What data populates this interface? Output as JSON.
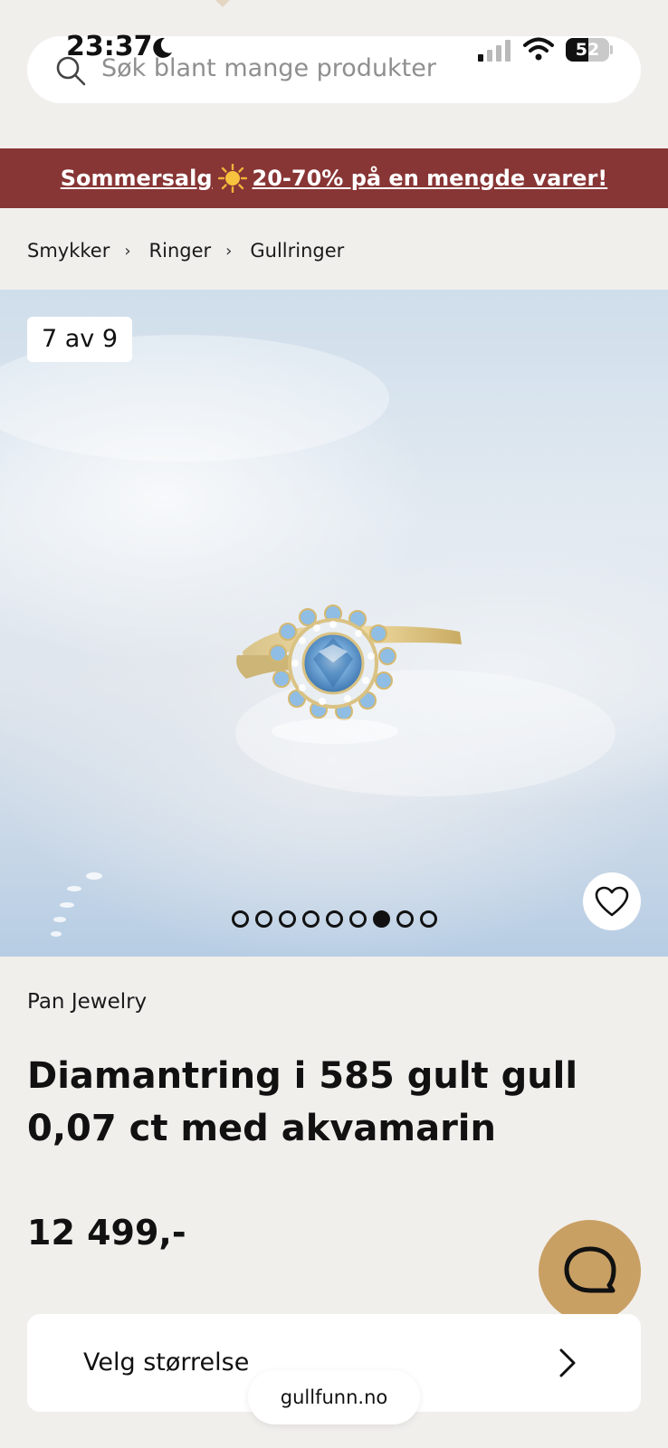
{
  "status_bar": {
    "time": "23:37",
    "battery_percent": 52,
    "battery_label": "52",
    "icons": [
      "moon-icon",
      "signal-icon",
      "wifi-icon",
      "battery-icon"
    ]
  },
  "search": {
    "placeholder": "Søk blant mange produkter",
    "icon": "search-icon"
  },
  "promo": {
    "text_before": "Sommersalg",
    "text_after": "20-70% på en mengde varer!",
    "icon": "sun-icon",
    "colors": {
      "background": "#883535",
      "text": "#ffffff"
    }
  },
  "breadcrumb": {
    "items": [
      "Smykker",
      "Ringer",
      "Gullringer"
    ],
    "separator": "›"
  },
  "gallery": {
    "counter": "7 av 9",
    "current_index": 7,
    "total": 9,
    "favorite_icon": "heart-icon"
  },
  "product": {
    "brand": "Pan Jewelry",
    "title": "Diamantring i 585 gult gull 0,07 ct med akvamarin",
    "price": "12 499,-"
  },
  "size_selector": {
    "label": "Velg størrelse",
    "icon": "chevron-right-icon"
  },
  "chat": {
    "icon": "chat-icon",
    "color": "#c9a064"
  },
  "browser": {
    "url": "gullfunn.no"
  }
}
